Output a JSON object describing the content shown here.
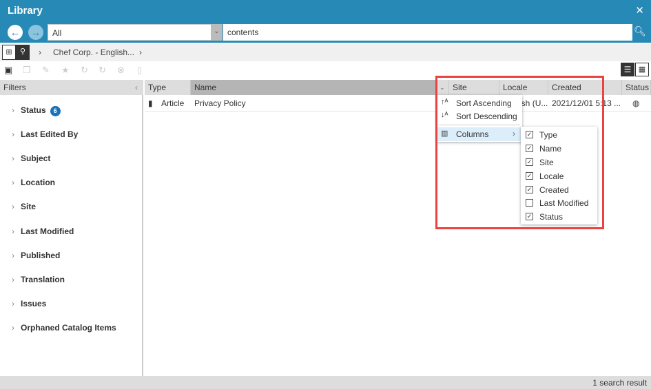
{
  "window": {
    "title": "Library",
    "close": "✕"
  },
  "search": {
    "scope": "All",
    "query": "contents"
  },
  "breadcrumb": {
    "items": [
      "Chef Corp. - English..."
    ]
  },
  "filters": {
    "title": "Filters",
    "items": [
      {
        "label": "Status",
        "badge": "6"
      },
      {
        "label": "Last Edited By"
      },
      {
        "label": "Subject"
      },
      {
        "label": "Location"
      },
      {
        "label": "Site"
      },
      {
        "label": "Last Modified"
      },
      {
        "label": "Published"
      },
      {
        "label": "Translation"
      },
      {
        "label": "Issues"
      },
      {
        "label": "Orphaned Catalog Items"
      }
    ]
  },
  "table": {
    "columns": [
      "Type",
      "Name",
      "Site",
      "Locale",
      "Created",
      "Status"
    ],
    "rows": [
      {
        "type": "Article",
        "name": "Privacy Policy",
        "site": "",
        "locale": "English (U...",
        "created": "2021/12/01 5:13 ...",
        "status": "globe-icon"
      }
    ]
  },
  "column_menu": {
    "sort_asc": "Sort Ascending",
    "sort_desc": "Sort Descending",
    "columns": "Columns",
    "column_options": [
      {
        "label": "Type",
        "checked": true
      },
      {
        "label": "Name",
        "checked": true
      },
      {
        "label": "Site",
        "checked": true
      },
      {
        "label": "Locale",
        "checked": true
      },
      {
        "label": "Created",
        "checked": true
      },
      {
        "label": "Last Modified",
        "checked": false
      },
      {
        "label": "Status",
        "checked": true
      }
    ]
  },
  "status": {
    "result_count": "1 search result"
  },
  "colors": {
    "header": "#2789b5",
    "highlight": "#e8433e",
    "menu_hover": "#dbeefa"
  }
}
